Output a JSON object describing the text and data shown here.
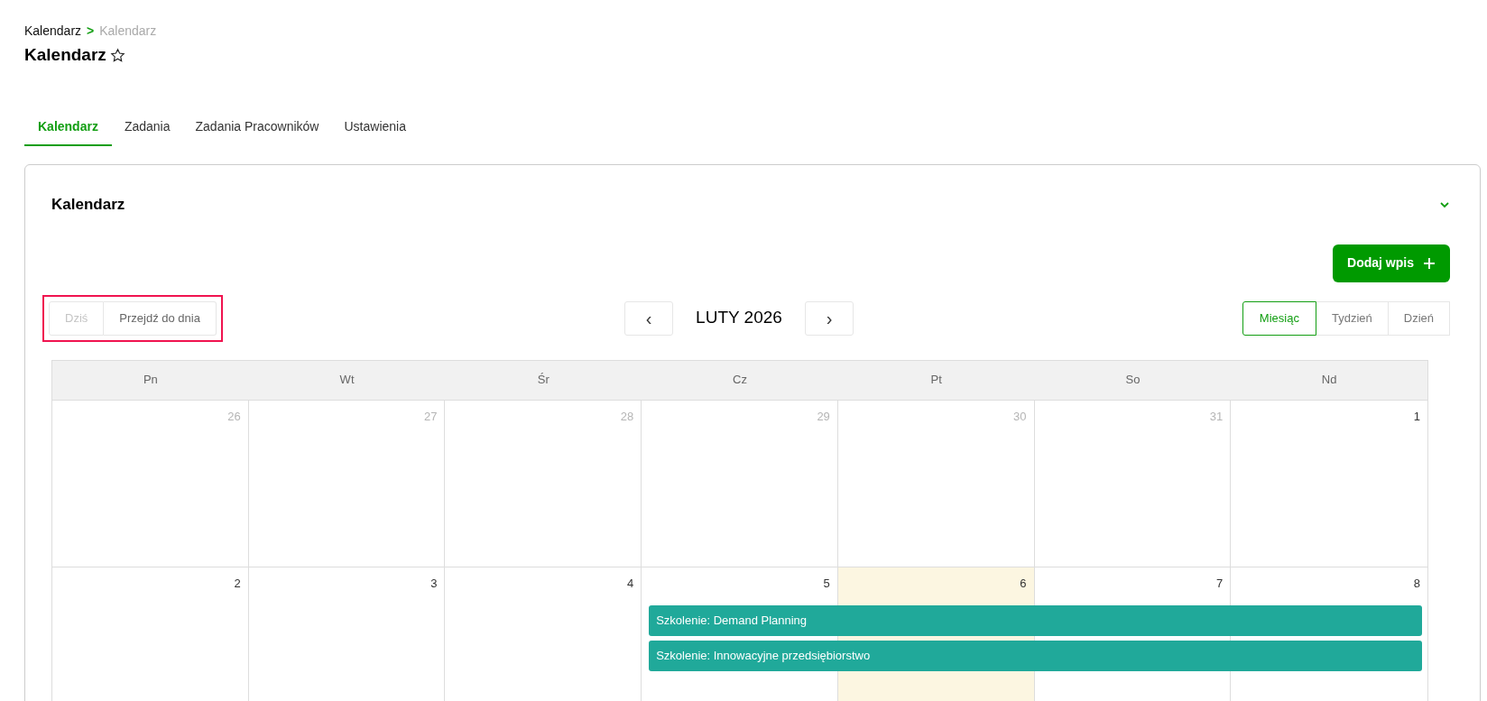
{
  "breadcrumb": [
    "Kalendarz",
    "Kalendarz"
  ],
  "breadcrumb_separator": ">",
  "page_title": "Kalendarz",
  "tabs": [
    {
      "label": "Kalendarz",
      "selected": true
    },
    {
      "label": "Zadania",
      "selected": false
    },
    {
      "label": "Zadania Pracowników",
      "selected": false
    },
    {
      "label": "Ustawienia",
      "selected": false
    }
  ],
  "panel": {
    "title": "Kalendarz",
    "expanded": true,
    "add_button": "Dodaj wpis",
    "today_button": {
      "label": "Dziś",
      "disabled": true
    },
    "goto_button": "Przejdź do dnia",
    "prev_button": "‹",
    "month_label": "LUTY 2026",
    "next_button": "›",
    "views": [
      {
        "label": "Miesiąc",
        "selected": true
      },
      {
        "label": "Tydzień",
        "selected": false
      },
      {
        "label": "Dzień",
        "selected": false
      }
    ],
    "weekdays": [
      "Pn",
      "Wt",
      "Śr",
      "Cz",
      "Pt",
      "So",
      "Nd"
    ],
    "weeks": [
      {
        "days": [
          {
            "label": "26",
            "other_month": true,
            "today": false
          },
          {
            "label": "27",
            "other_month": true,
            "today": false
          },
          {
            "label": "28",
            "other_month": true,
            "today": false
          },
          {
            "label": "29",
            "other_month": true,
            "today": false
          },
          {
            "label": "30",
            "other_month": true,
            "today": false
          },
          {
            "label": "31",
            "other_month": true,
            "today": false
          },
          {
            "label": "1",
            "other_month": false,
            "today": false
          }
        ]
      },
      {
        "days": [
          {
            "label": "2",
            "other_month": false,
            "today": false
          },
          {
            "label": "3",
            "other_month": false,
            "today": false
          },
          {
            "label": "4",
            "other_month": false,
            "today": false
          },
          {
            "label": "5",
            "other_month": false,
            "today": false,
            "events": [
              {
                "title": "Szkolenie: Demand Planning",
                "to_week_end": true
              },
              {
                "title": "Szkolenie: Innowacyjne przedsiębiorstwo",
                "to_week_end": true
              }
            ]
          },
          {
            "label": "6",
            "other_month": false,
            "today": true
          },
          {
            "label": "7",
            "other_month": false,
            "today": false
          },
          {
            "label": "8",
            "other_month": false,
            "today": false
          }
        ]
      }
    ]
  }
}
